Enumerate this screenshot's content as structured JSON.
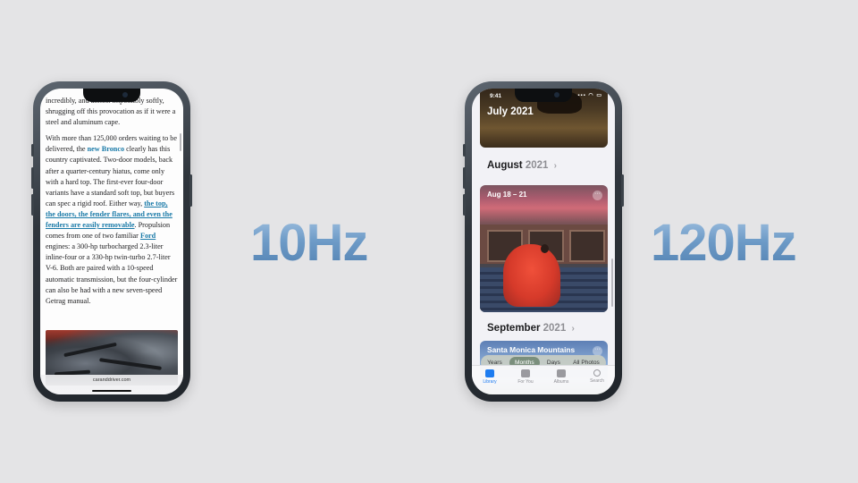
{
  "left_phone": {
    "article": {
      "p1": "incredibly, and almost impossibly softly, shrugging off this provocation as if it were a steel and aluminum cape.",
      "p2_a": "With more than 125,000 orders waiting to be delivered, the ",
      "p2_link1": "new Bronco",
      "p2_b": " clearly has this country captivated. Two-door models, back after a quarter-century hiatus, come only with a hard top. The first-ever four-door variants have a standard soft top, but buyers can spec a rigid roof. Either way, ",
      "p2_link2": "the top, the doors, the fender flares, and even the fenders are easily removable",
      "p2_c": ". Propulsion comes from one of two familiar ",
      "p2_link3": "Ford",
      "p2_d": " engines: a 300-hp turbocharged 2.3-liter inline-four or a 330-hp twin-turbo 2.7-liter V-6. Both are paired with a 10-speed automatic transmission, but the four-cylinder can also be had with a new seven-speed Getrag manual."
    },
    "url": "caranddriver.com"
  },
  "labels": {
    "left_hz": "10Hz",
    "right_hz": "120Hz"
  },
  "right_phone": {
    "status_time": "9:41",
    "status_icons": "▪▪▪ ◠ ▭",
    "july_title": "July 2021",
    "aug_month": "August",
    "aug_year": "2021",
    "aug_card_title": "Aug 18 – 21",
    "sep_month": "September",
    "sep_year": "2021",
    "sep_card_title": "Santa Monica Mountains",
    "chevron": "›",
    "more": "···",
    "segments": [
      "Years",
      "Months",
      "Days",
      "All Photos"
    ],
    "active_segment": "Months",
    "tabs": [
      "Library",
      "For You",
      "Albums",
      "Search"
    ]
  },
  "colors": {
    "background": "#e4e4e6",
    "hz_gradient_top": "#a8c6e4",
    "hz_gradient_bottom": "#4f7fb0",
    "link": "#1a7aa8",
    "tab_active": "#1e7cf0"
  }
}
